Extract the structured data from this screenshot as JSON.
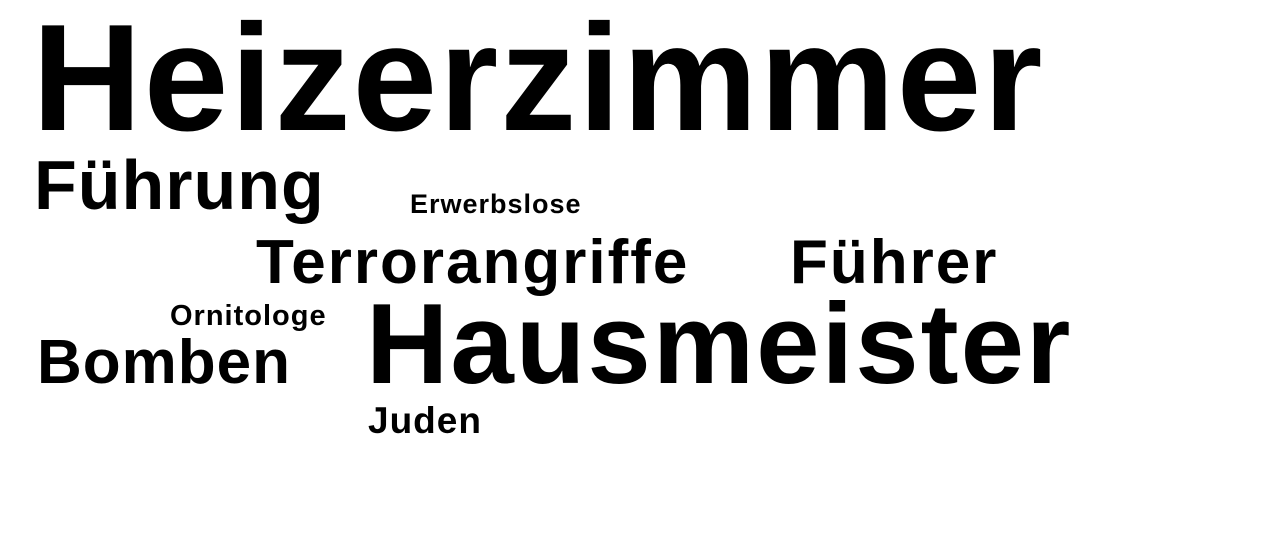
{
  "word_cloud": {
    "text_color": "#000000",
    "background_color": "#ffffff",
    "words": [
      {
        "id": "heizerzimmer",
        "text": "Heizerzimmer"
      },
      {
        "id": "fuehrung",
        "text": "Führung"
      },
      {
        "id": "erwerbslose",
        "text": "Erwerbslose"
      },
      {
        "id": "terrorangriffe",
        "text": "Terrorangriffe"
      },
      {
        "id": "fuehrer",
        "text": "Führer"
      },
      {
        "id": "ornitologe",
        "text": "Ornitologe"
      },
      {
        "id": "hausmeister",
        "text": "Hausmeister"
      },
      {
        "id": "bomben",
        "text": "Bomben"
      },
      {
        "id": "juden",
        "text": "Juden"
      }
    ]
  }
}
